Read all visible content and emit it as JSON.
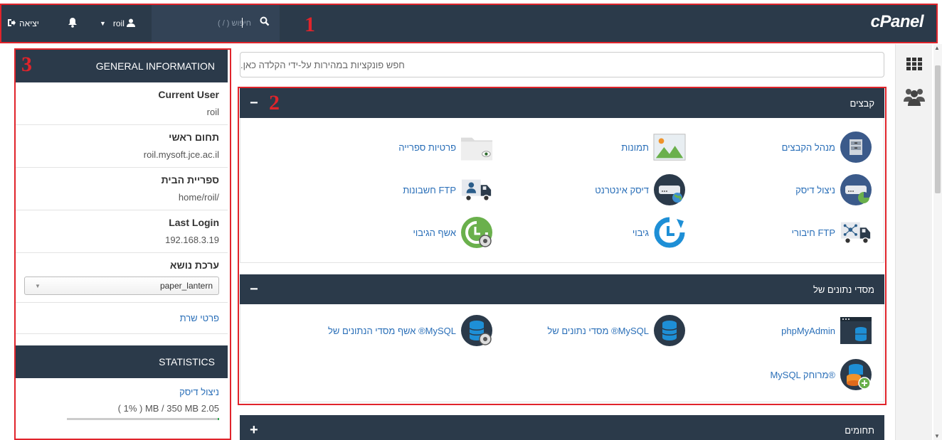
{
  "topbar": {
    "logout_label": "יציאה",
    "username": "roil",
    "search_placeholder": "חיפוש ( / )",
    "logo": "cPanel"
  },
  "annotations": [
    "1",
    "2",
    "3"
  ],
  "general_info": {
    "header": "GENERAL INFORMATION",
    "rows": [
      {
        "label": "Current User",
        "value": "roil"
      },
      {
        "label": "תחום ראשי",
        "value": "roil.mysoft.jce.ac.il"
      },
      {
        "label": "ספריית הבית",
        "value": "home/roil/"
      },
      {
        "label": "Last Login",
        "value": "192.168.3.19"
      },
      {
        "label": "ערכת נושא",
        "value": "paper_lantern"
      }
    ],
    "server_info_link": "פרטי שרת"
  },
  "statistics": {
    "header": "STATISTICS",
    "disk_usage_link": "ניצול דיסק",
    "disk_usage_value": "( 1% ) MB / 350 MB 2.05",
    "disk_usage_fraction": 0.01
  },
  "main": {
    "search_placeholder": "חפש פונקציות במהירות על-ידי הקלדה כאן.",
    "groups": [
      {
        "title": "קבצים",
        "toggle": "−",
        "items": [
          "מנהל הקבצים",
          "תמונות",
          "פרטיות ספרייה",
          "ניצול דיסק",
          "דיסק אינטרנט",
          "חשבונות FTP",
          "חיבורי FTP",
          "גיבוי",
          "אשף הגיבוי"
        ]
      },
      {
        "title": "מסדי נתונים של",
        "toggle": "−",
        "items": [
          "phpMyAdmin",
          "מסדי נתונים של ®MySQL",
          "אשף מסדי הנתונים של ®MySQL",
          "MySQL מרוחק®"
        ]
      },
      {
        "title": "תחומים",
        "toggle": "+"
      }
    ]
  },
  "colors": {
    "header_bg": "#2b3a4a",
    "link": "#2a6fb8",
    "annotation": "#e0242b"
  }
}
